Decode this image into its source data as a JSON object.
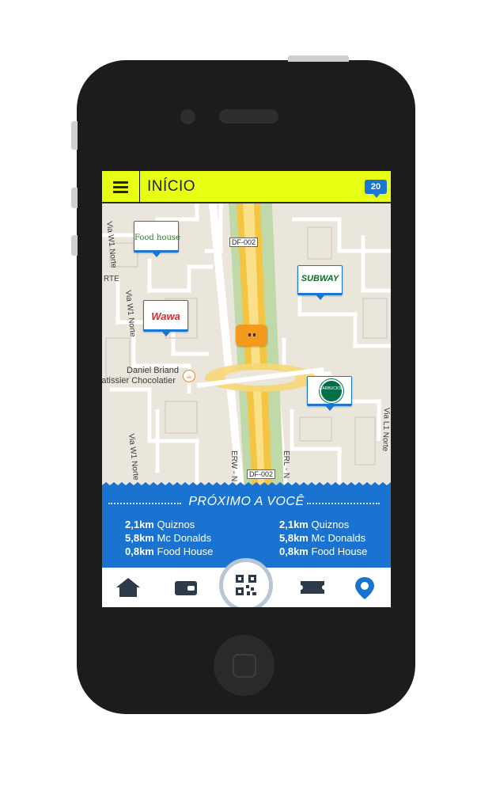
{
  "header": {
    "title": "INÍCIO",
    "notification_count": "20"
  },
  "map": {
    "street_labels": [
      "Via W1 Norte",
      "Via W1 Norte",
      "RTE",
      "ERW - N",
      "ERL - N",
      "Via L1 Norte"
    ],
    "road_tags": [
      "DF-002",
      "DF-002"
    ],
    "poi": {
      "line1": "Daniel Briand",
      "line2": "Patissier Chocolatier"
    },
    "pins": [
      {
        "name": "Food house"
      },
      {
        "name": "SUBWAY"
      },
      {
        "name": "Wawa"
      },
      {
        "name": "STARBUCKS"
      }
    ]
  },
  "nearby": {
    "title": "PRÓXIMO A VOCÊ",
    "columns": [
      [
        {
          "distance": "2,1km",
          "place": "Quiznos"
        },
        {
          "distance": "5,8km",
          "place": "Mc Donalds"
        },
        {
          "distance": "0,8km",
          "place": "Food House"
        }
      ],
      [
        {
          "distance": "2,1km",
          "place": "Quiznos"
        },
        {
          "distance": "5,8km",
          "place": "Mc Donalds"
        },
        {
          "distance": "0,8km",
          "place": "Food House"
        }
      ]
    ]
  },
  "tabs": [
    {
      "icon": "home-icon"
    },
    {
      "icon": "wallet-icon"
    },
    {
      "icon": "qr-code-icon"
    },
    {
      "icon": "ticket-icon"
    },
    {
      "icon": "location-pin-icon"
    }
  ],
  "colors": {
    "accent_yellow": "#e6ff12",
    "brand_blue": "#1a73d1",
    "car_orange": "#f39a1c"
  }
}
